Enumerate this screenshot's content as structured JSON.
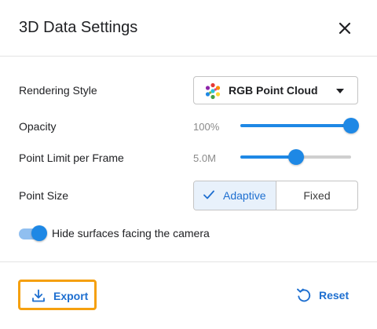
{
  "dialog": {
    "title": "3D Data Settings",
    "close_icon": "close-icon"
  },
  "rendering_style": {
    "label": "Rendering Style",
    "selected": "RGB Point Cloud",
    "icon": "rgb-cube-icon"
  },
  "opacity": {
    "label": "Opacity",
    "value_text": "100%",
    "fraction": 1.0
  },
  "point_limit": {
    "label": "Point Limit per Frame",
    "value_text": "5.0M",
    "fraction": 0.5
  },
  "point_size": {
    "label": "Point Size",
    "options": [
      "Adaptive",
      "Fixed"
    ],
    "selected": "Adaptive"
  },
  "hide_surfaces": {
    "label": "Hide surfaces facing the camera",
    "enabled": true
  },
  "footer": {
    "export_label": "Export",
    "export_icon": "download-icon",
    "reset_label": "Reset",
    "reset_icon": "reset-icon"
  },
  "colors": {
    "accent": "#1e88e5",
    "accent_text": "#1e6fd0",
    "highlight_border": "#f5a00f",
    "selected_segment_bg": "#e8f1fb"
  }
}
